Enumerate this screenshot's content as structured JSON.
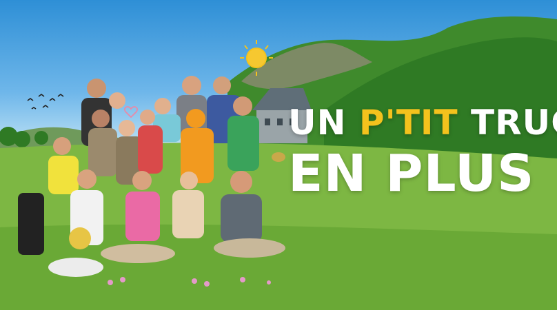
{
  "poster": {
    "title_line1_part1": "UN ",
    "title_line1_accent": "P'TIT",
    "title_line1_part2": " TRUC",
    "title_line2": "EN PLUS",
    "colors": {
      "title": "#ffffff",
      "accent": "#f4c21d",
      "sky": "#2e8fd6",
      "grass": "#7fb844",
      "hills": "#3f8a2c"
    },
    "icons": [
      "sun-doodle-icon",
      "birds-icon",
      "heart-doodle-icon",
      "flowers-doodle-icon"
    ]
  }
}
